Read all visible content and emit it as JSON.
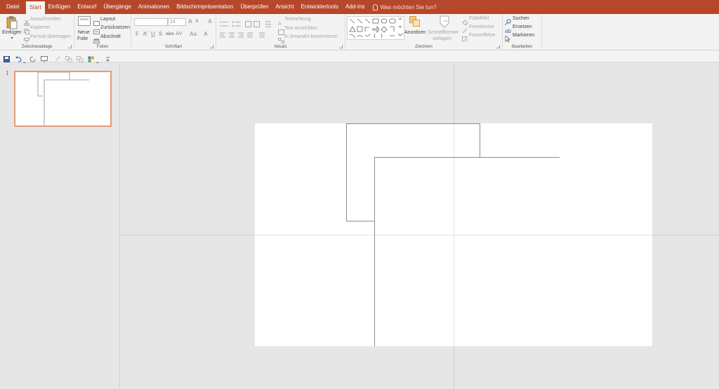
{
  "tabs": [
    {
      "label": "Datei"
    },
    {
      "label": "Start",
      "active": true
    },
    {
      "label": "Einfügen"
    },
    {
      "label": "Entwurf"
    },
    {
      "label": "Übergänge"
    },
    {
      "label": "Animationen"
    },
    {
      "label": "Bildschirmpräsentation"
    },
    {
      "label": "Überprüfen"
    },
    {
      "label": "Ansicht"
    },
    {
      "label": "Entwicklertools"
    },
    {
      "label": "Add-Ins"
    }
  ],
  "tell_me": "Was möchten Sie tun?",
  "ribbon": {
    "clipboard": {
      "label": "Zwischenablage",
      "paste": "Einfügen",
      "cut": "Ausschneiden",
      "copy": "Kopieren",
      "format_painter": "Format übertragen"
    },
    "slides": {
      "label": "Folien",
      "new_slide_1": "Neue",
      "new_slide_2": "Folie",
      "layout": "Layout",
      "reset": "Zurücksetzen",
      "section": "Abschnitt"
    },
    "font": {
      "label": "Schriftart",
      "font_name": "",
      "font_size": "24",
      "bold": "F",
      "italic": "K",
      "underline": "U",
      "strike": "S",
      "shadow": "abc",
      "spacing": "AV",
      "case": "Aa",
      "color": "A"
    },
    "paragraph": {
      "label": "Absatz",
      "text_direction": "Textrichtung",
      "align_text": "Text ausrichten",
      "smartart": "In SmartArt konvertieren"
    },
    "drawing": {
      "label": "Zeichnen",
      "arrange": "Anordnen",
      "quick_styles_1": "Schnellformat-",
      "quick_styles_2": "vorlagen",
      "fill": "Fülleffekt",
      "outline": "Formkontur",
      "effects": "Formeffekte"
    },
    "editing": {
      "label": "Bearbeiten",
      "find": "Suchen",
      "replace": "Ersetzen",
      "select": "Markieren"
    }
  },
  "slides_panel": {
    "slide_number": "1"
  },
  "colors": {
    "accent": "#b7472a",
    "thumb_border": "#e39a7f"
  },
  "icons": [
    "save-icon",
    "undo-icon",
    "redo-icon",
    "paste-icon",
    "new-slide-icon",
    "find-icon",
    "lightbulb-icon"
  ]
}
